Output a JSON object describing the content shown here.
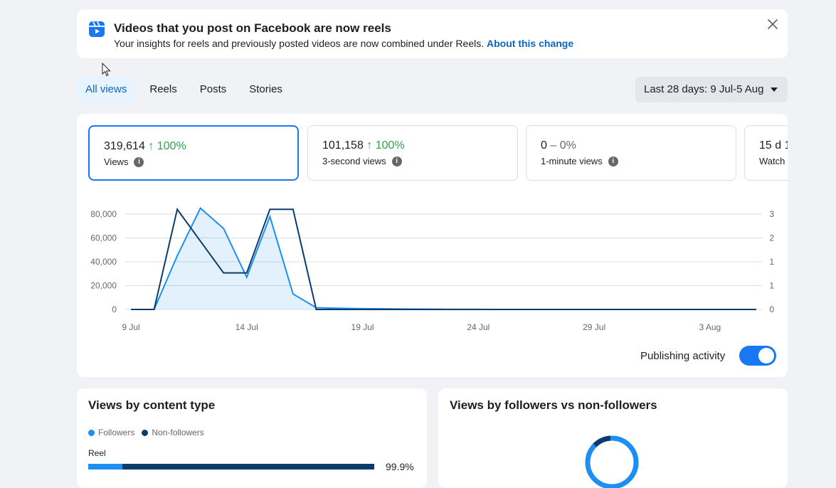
{
  "notice": {
    "title": "Videos that you post on Facebook are now reels",
    "description": "Your insights for reels and previously posted videos are now combined under Reels.",
    "link": "About this change",
    "icon": "reels-icon",
    "close_icon": "close-icon"
  },
  "tabs": [
    {
      "label": "All views",
      "active": true
    },
    {
      "label": "Reels",
      "active": false
    },
    {
      "label": "Posts",
      "active": false
    },
    {
      "label": "Stories",
      "active": false
    }
  ],
  "date_range": "Last 28 days: 9 Jul-5 Aug",
  "metrics": [
    {
      "value": "319,614",
      "change": "↑ 100%",
      "trend": "up",
      "label": "Views",
      "active": true
    },
    {
      "value": "101,158",
      "change": "↑ 100%",
      "trend": "up",
      "label": "3-second views",
      "active": false
    },
    {
      "value": "0",
      "change": "– 0%",
      "trend": "flat",
      "label": "1-minute views",
      "active": false
    },
    {
      "value": "15 d 1",
      "change": "",
      "trend": "flat",
      "label": "Watch",
      "active": false
    }
  ],
  "chart_data": {
    "type": "line",
    "x": [
      "9 Jul",
      "10 Jul",
      "11 Jul",
      "12 Jul",
      "13 Jul",
      "14 Jul",
      "15 Jul",
      "16 Jul",
      "17 Jul",
      "18 Jul",
      "19 Jul",
      "20 Jul",
      "21 Jul",
      "22 Jul",
      "23 Jul",
      "24 Jul",
      "25 Jul",
      "26 Jul",
      "27 Jul",
      "28 Jul",
      "29 Jul",
      "30 Jul",
      "31 Jul",
      "1 Aug",
      "2 Aug",
      "3 Aug",
      "4 Aug",
      "5 Aug"
    ],
    "x_tick_labels": [
      "9 Jul",
      "14 Jul",
      "19 Jul",
      "24 Jul",
      "29 Jul",
      "3 Aug"
    ],
    "y_left_ticks": [
      "0",
      "20,000",
      "40,000",
      "60,000",
      "80,000"
    ],
    "y_right_ticks": [
      "0",
      "1",
      "1",
      "2",
      "3"
    ],
    "ylim_left": [
      0,
      80000
    ],
    "ylim_right": [
      0,
      3
    ],
    "series": [
      {
        "axis": "left",
        "color": "#1b8ff2",
        "area": true,
        "values": [
          0,
          0,
          45000,
          85000,
          68000,
          27000,
          78000,
          13000,
          1500,
          1000,
          700,
          500,
          300,
          200,
          100,
          50,
          0,
          0,
          0,
          0,
          0,
          0,
          0,
          0,
          0,
          0,
          0,
          0
        ]
      },
      {
        "axis": "right",
        "color": "#0a3d6b",
        "area": false,
        "values": [
          0,
          0,
          3.15,
          2.15,
          1.15,
          1.15,
          3.15,
          3.15,
          0,
          0,
          0,
          0,
          0,
          0,
          0,
          0,
          0,
          0,
          0,
          0,
          0,
          0,
          0,
          0,
          0,
          0,
          0,
          0
        ]
      }
    ]
  },
  "publishing": {
    "label": "Publishing activity",
    "on": true
  },
  "content_type": {
    "title": "Views by content type",
    "legend": [
      "Followers",
      "Non-followers"
    ],
    "colors": {
      "followers": "#1b8ff2",
      "non_followers": "#0a3d6b"
    },
    "row_label": "Reel",
    "followers_share": 12,
    "percent": "99.9%"
  },
  "followers_card": {
    "title": "Views by followers vs non-followers"
  }
}
